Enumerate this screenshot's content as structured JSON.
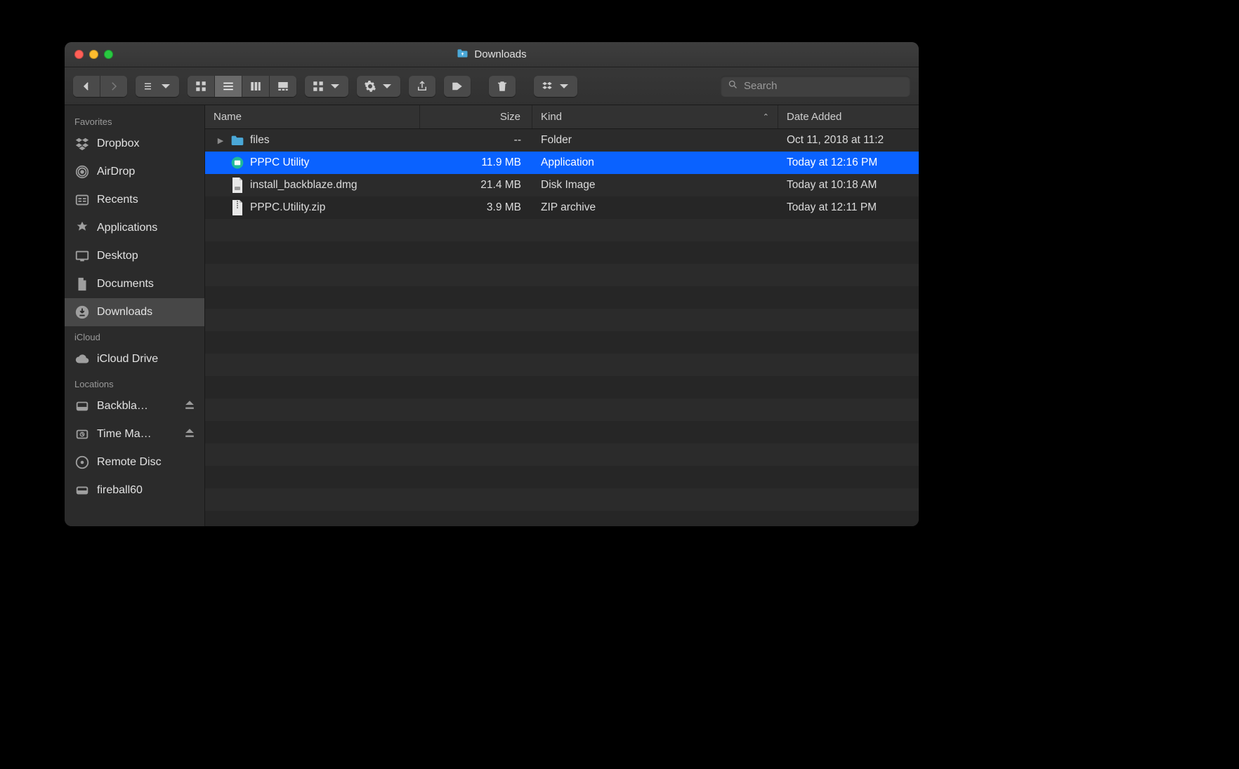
{
  "window": {
    "title": "Downloads"
  },
  "toolbar": {
    "search_placeholder": "Search"
  },
  "columns": {
    "name": "Name",
    "size": "Size",
    "kind": "Kind",
    "date_added": "Date Added",
    "sort_column": "kind",
    "sort_direction": "asc"
  },
  "sidebar": {
    "sections": [
      {
        "label": "Favorites",
        "items": [
          {
            "id": "dropbox",
            "label": "Dropbox",
            "icon": "dropbox"
          },
          {
            "id": "airdrop",
            "label": "AirDrop",
            "icon": "airdrop"
          },
          {
            "id": "recents",
            "label": "Recents",
            "icon": "recents"
          },
          {
            "id": "applications",
            "label": "Applications",
            "icon": "apps"
          },
          {
            "id": "desktop",
            "label": "Desktop",
            "icon": "desktop"
          },
          {
            "id": "documents",
            "label": "Documents",
            "icon": "documents"
          },
          {
            "id": "downloads",
            "label": "Downloads",
            "icon": "downloads",
            "active": true
          }
        ]
      },
      {
        "label": "iCloud",
        "items": [
          {
            "id": "icloud-drive",
            "label": "iCloud Drive",
            "icon": "cloud"
          }
        ]
      },
      {
        "label": "Locations",
        "items": [
          {
            "id": "backblaze",
            "label": "Backbla…",
            "icon": "drive",
            "ejectable": true
          },
          {
            "id": "timemachine",
            "label": "Time Ma…",
            "icon": "tmdrive",
            "ejectable": true
          },
          {
            "id": "remote-disc",
            "label": "Remote Disc",
            "icon": "disc"
          },
          {
            "id": "fireball60",
            "label": "fireball60",
            "icon": "network"
          }
        ]
      }
    ]
  },
  "files": [
    {
      "name": "files",
      "size": "--",
      "kind": "Folder",
      "date_added": "Oct 11, 2018 at 11:2",
      "icon": "folder",
      "expandable": true
    },
    {
      "name": "PPPC Utility",
      "size": "11.9 MB",
      "kind": "Application",
      "date_added": "Today at 12:16 PM",
      "icon": "app-green",
      "selected": true
    },
    {
      "name": "install_backblaze.dmg",
      "size": "21.4 MB",
      "kind": "Disk Image",
      "date_added": "Today at 10:18 AM",
      "icon": "dmg"
    },
    {
      "name": "PPPC.Utility.zip",
      "size": "3.9 MB",
      "kind": "ZIP archive",
      "date_added": "Today at 12:11 PM",
      "icon": "zip"
    }
  ]
}
